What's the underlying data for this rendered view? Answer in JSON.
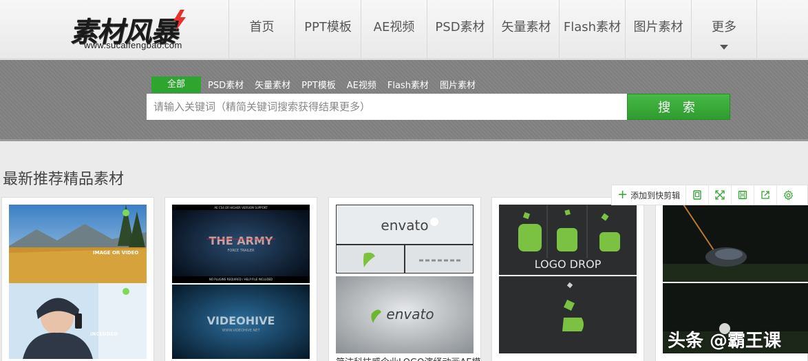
{
  "header": {
    "logo_title": "素材风暴",
    "logo_url": "www.sucaifengbao.com",
    "nav": [
      {
        "label": "首页",
        "name": "nav-home",
        "width": 96
      },
      {
        "label": "PPT模板",
        "name": "nav-ppt",
        "width": 96
      },
      {
        "label": "AE视频",
        "name": "nav-ae",
        "width": 96
      },
      {
        "label": "PSD素材",
        "name": "nav-psd",
        "width": 96
      },
      {
        "label": "矢量素材",
        "name": "nav-vector",
        "width": 96
      },
      {
        "label": "Flash素材",
        "name": "nav-flash",
        "width": 96
      },
      {
        "label": "图片素材",
        "name": "nav-image",
        "width": 96
      },
      {
        "label": "更多",
        "name": "nav-more",
        "width": 96
      }
    ]
  },
  "search": {
    "tabs": [
      "全部",
      "PSD素材",
      "矢量素材",
      "PPT模板",
      "AE视频",
      "Flash素材",
      "图片素材"
    ],
    "placeholder": "请输入关键词（精简关键词搜索获得结果更多）",
    "button_label": "搜 索"
  },
  "main": {
    "section_title": "最新推荐精品素材",
    "toolbar": {
      "add_label": "添加到快剪辑"
    },
    "cards": [
      {
        "thumb_texts": [
          "IMAGE OR VIDEO",
          "INCLUDED"
        ]
      },
      {
        "thumb_texts": [
          "THE ARMY",
          "FORCE TRAILER",
          "VIDEOHIVE",
          "WWW.VIDEOHIVE.NET",
          "AE CS4 OR HIGHER VERSION SUPPORT",
          "NO PLUGINS REQUIRED / HELP FILE INCLUDED"
        ]
      },
      {
        "thumb_texts": [
          "envato",
          "envato"
        ],
        "caption": "简洁科技感企业LOGO演绎动画AE模"
      },
      {
        "thumb_texts": [
          "LOGO DROP"
        ]
      },
      {
        "thumb_texts": []
      }
    ],
    "watermark": "头条 @霸王课"
  },
  "colors": {
    "accent_green": "#2ea52e",
    "band_gray": "#7e7e7e"
  }
}
